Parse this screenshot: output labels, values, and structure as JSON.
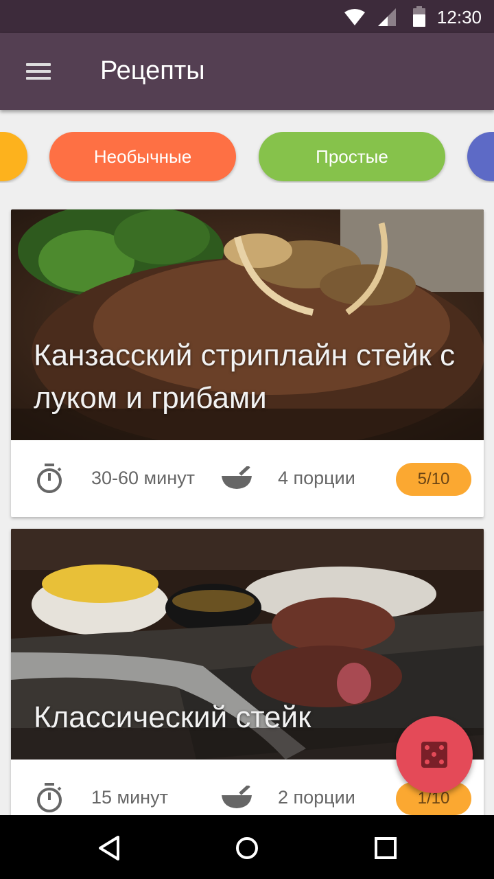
{
  "status_bar": {
    "time": "12:30",
    "icons": [
      "wifi-icon",
      "signal-icon",
      "battery-icon"
    ]
  },
  "app_bar": {
    "title": "Рецепты",
    "menu_icon": "hamburger-menu-icon"
  },
  "filters": [
    {
      "label": "",
      "color": "#fdb21d"
    },
    {
      "label": "Необычные",
      "color": "#fe7044"
    },
    {
      "label": "Простые",
      "color": "#86c24b"
    },
    {
      "label": "",
      "color": "#5d6ac6"
    }
  ],
  "recipes": [
    {
      "title": "Канзасский стриплайн стейк с луком и грибами",
      "time": "30-60 минут",
      "servings": "4 порции",
      "rating": "5/10"
    },
    {
      "title": "Классический стейк",
      "time": "15 минут",
      "servings": "2 порции",
      "rating": "1/10"
    }
  ],
  "fab": {
    "icon": "dice-icon"
  },
  "nav": {
    "icons": [
      "back-icon",
      "home-icon",
      "recents-icon"
    ]
  },
  "colors": {
    "status_bar": "#3d2b3b",
    "app_bar": "#543f52",
    "rating_badge": "#fba831",
    "fab": "#e44a58"
  }
}
